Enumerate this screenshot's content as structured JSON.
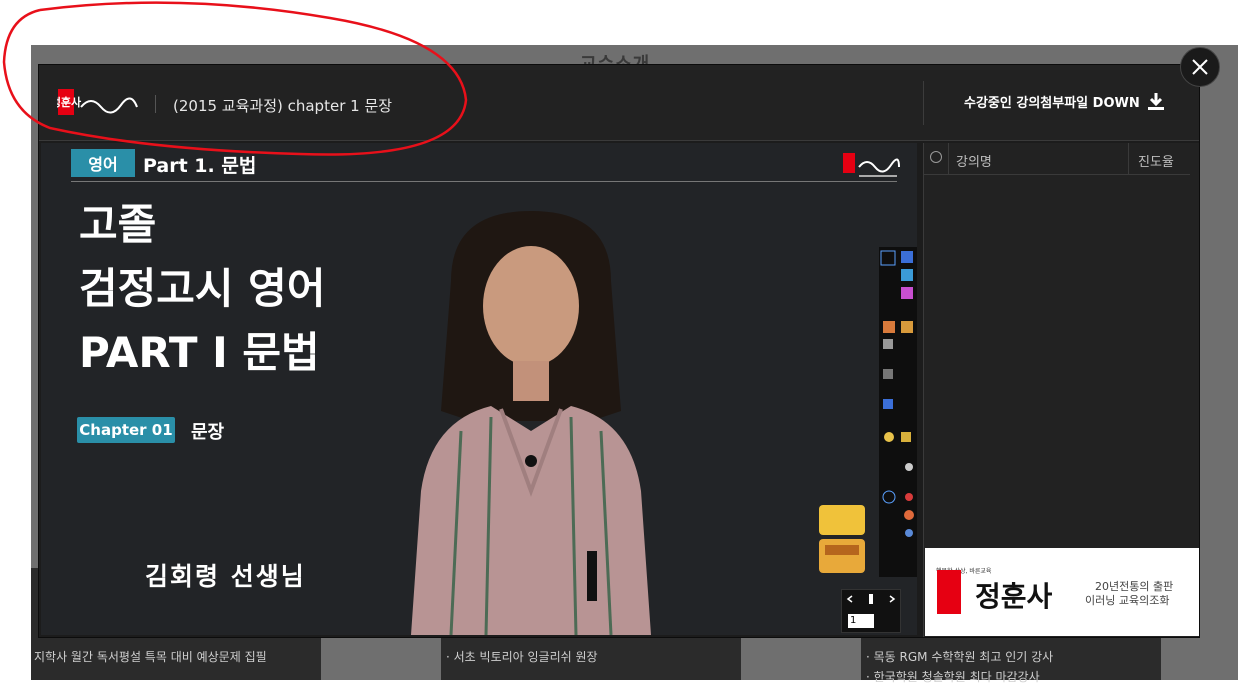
{
  "background": {
    "title": "교수소개",
    "cards": [
      {
        "text": "지학사 월간 독서평설 특목 대비 예상문제 집필"
      },
      {
        "text": "· 서초 빅토리아 잉글리쉬 원장"
      },
      {
        "text": "· 목동 RGM 수학학원 최고 인기 강사"
      },
      {
        "text": "· 한국학원 청솔학원 최다 마감강사"
      }
    ]
  },
  "header": {
    "logo_text": "정훈사",
    "course_title": "(2015 교육과정) chapter 1 문장",
    "download_label": "수강중인 강의첨부파일 DOWN"
  },
  "video": {
    "subject": "영어",
    "part": "Part 1. 문법",
    "title_lines": [
      "고졸",
      "검정고시 영어",
      "PART I 문법"
    ],
    "chapter_badge": "Chapter 01",
    "chapter_name": "문장",
    "teacher": "김회령 선생님",
    "page_value": "1"
  },
  "list": {
    "col_name": "강의명",
    "col_progress": "진도율"
  },
  "ad": {
    "slogan": "행복한 상상, 바른교육",
    "brand": "정훈사",
    "line1": "20년전통의 출판",
    "line2": "이러닝 교육의조화"
  },
  "colors": {
    "accent_teal": "#2a8fa8",
    "brand_red": "#e60012",
    "annotation_red": "#e8101a"
  }
}
